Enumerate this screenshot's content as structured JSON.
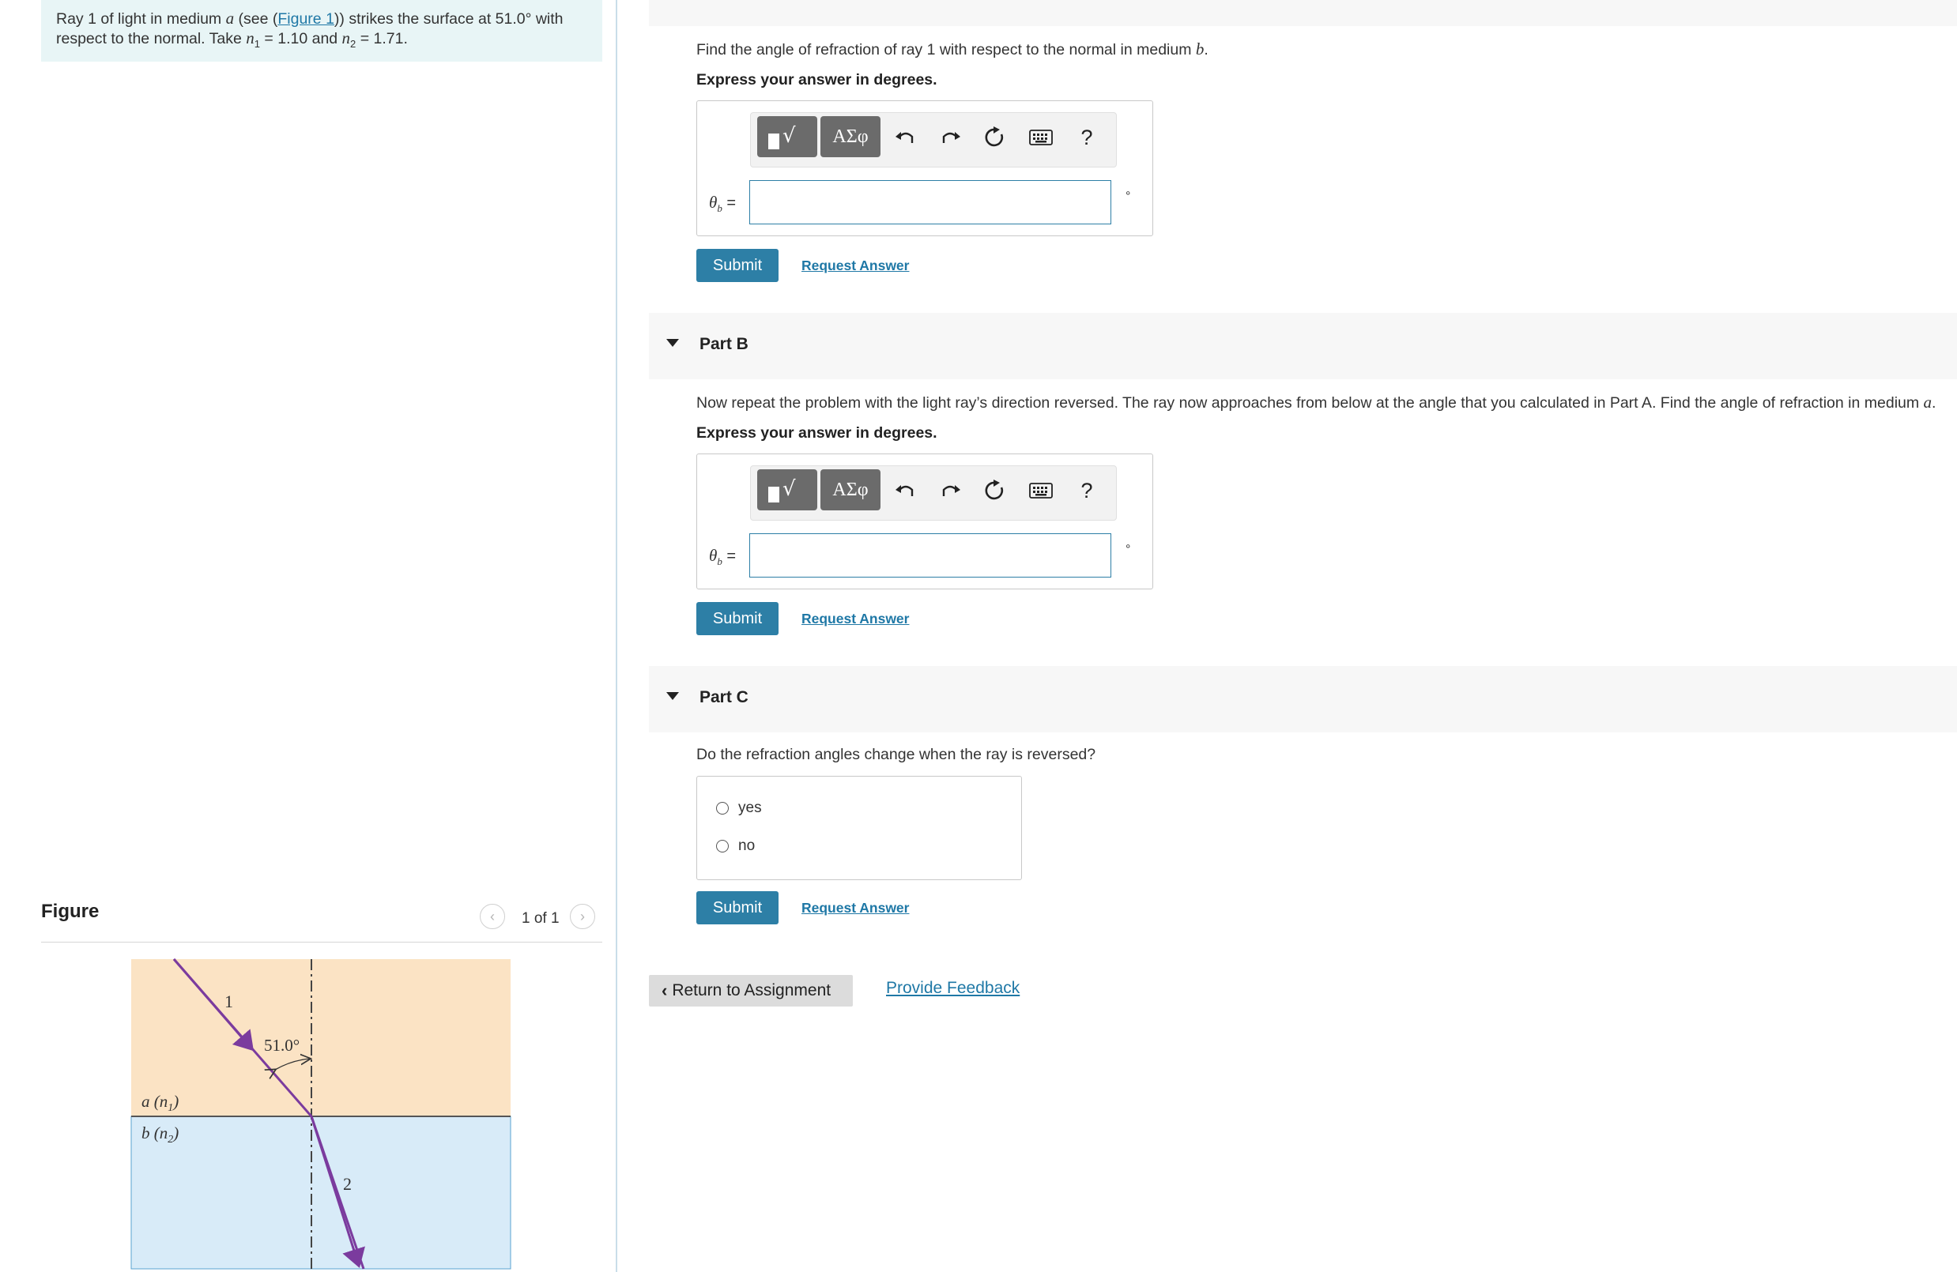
{
  "problem": {
    "text_before_var": "Ray 1 of light in medium ",
    "var_a": "a",
    "text_see": " (see (",
    "figure_link": "Figure 1",
    "text_strikes": ")) strikes the surface at 51.0° with",
    "line2_before": "respect to the normal. Take ",
    "n1_symbol": "n",
    "n1_sub": "1",
    "n1_value": " = 1.10 and ",
    "n2_symbol": "n",
    "n2_sub": "2",
    "n2_value": " = 1.71."
  },
  "figure": {
    "title": "Figure",
    "count": "1 of 1",
    "prev_icon": "chevron-left-icon",
    "next_icon": "chevron-right-icon",
    "ray1_label": "1",
    "ray2_label": "2",
    "angle_label": "51.0°",
    "medium_a_label": "a (n",
    "medium_a_sub": "1",
    "medium_b_label": "b (n",
    "medium_b_sub": "2",
    "close_paren": ")",
    "colors": {
      "medium_a": "#fbe3c4",
      "medium_b": "#d8ebf8",
      "ray": "#7b3b9e"
    }
  },
  "part_a": {
    "question_before": "Find the angle of refraction of ray 1 with respect to the normal in medium ",
    "question_var": "b",
    "question_after": ".",
    "express": "Express your answer in degrees.",
    "theta_symbol": "θ",
    "theta_sub": "b",
    "equals": " =",
    "input_value": "",
    "degree": "°",
    "submit": "Submit",
    "request": "Request Answer"
  },
  "part_b": {
    "title": "Part B",
    "question_before": "Now repeat the problem with the light ray’s direction reversed. The ray now approaches from below at the angle that you calculated in Part A. Find the angle of refraction in medium ",
    "question_var": "a",
    "question_after": ".",
    "express": "Express your answer in degrees.",
    "theta_symbol": "θ",
    "theta_sub": "b",
    "equals": " =",
    "input_value": "",
    "degree": "°",
    "submit": "Submit",
    "request": "Request Answer"
  },
  "part_c": {
    "title": "Part C",
    "question": "Do the refraction angles change when the ray is reversed?",
    "options": [
      "yes",
      "no"
    ],
    "submit": "Submit",
    "request": "Request Answer"
  },
  "toolbar": {
    "greek_label": "ΑΣφ",
    "help_label": "?",
    "icons": [
      "templates-icon",
      "greek-symbols-icon",
      "undo-icon",
      "redo-icon",
      "reset-icon",
      "keyboard-icon",
      "help-icon"
    ]
  },
  "footer": {
    "return_label": "Return to Assignment",
    "feedback_label": "Provide Feedback"
  },
  "colors": {
    "accent": "#2d7fa6",
    "link": "#1f78a6",
    "problem_bg": "#e8f5f6",
    "part_header_bg": "#f7f7f7"
  }
}
